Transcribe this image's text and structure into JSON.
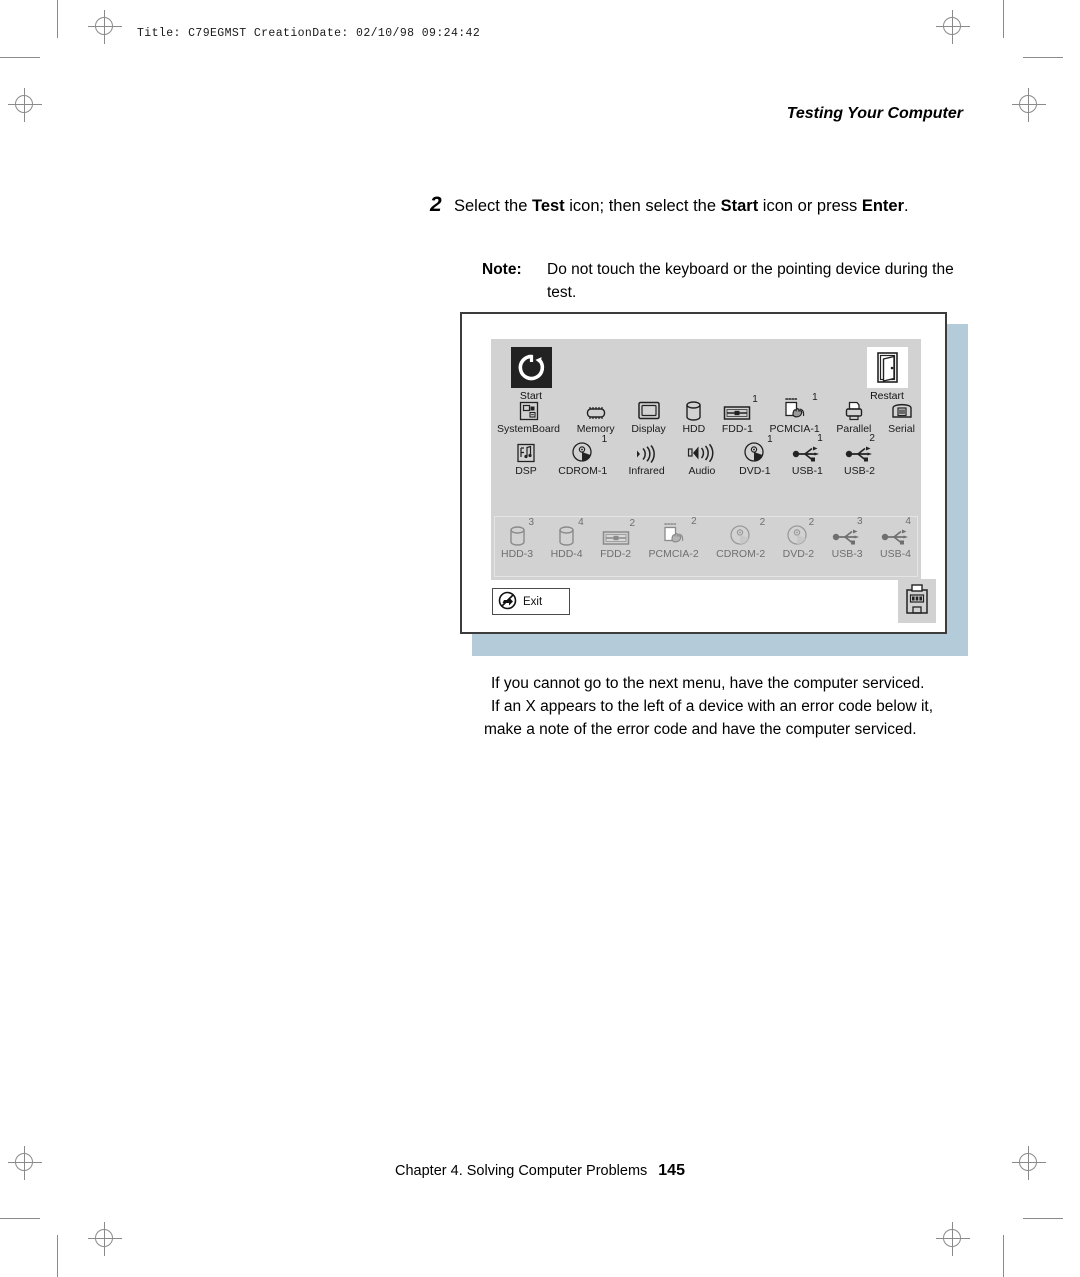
{
  "page": {
    "job_info": "Title: C79EGMST CreationDate: 02/10/98 09:24:42",
    "running_head": "Testing Your Computer",
    "footer_text": "Chapter 4.  Solving Computer Problems",
    "page_number": "145"
  },
  "step": {
    "number": "2",
    "text_part1": "Select the ",
    "bold1": "Test",
    "text_part2": " icon; then select the ",
    "bold2": "Start",
    "text_part3": " icon or press ",
    "bold3": "Enter",
    "text_part4": "."
  },
  "note": {
    "label": "Note:",
    "text": "Do not touch the keyboard or the pointing device during the test."
  },
  "figure": {
    "start_tile": {
      "label": "Start",
      "icon": "circular-arrow-icon"
    },
    "restart_tile": {
      "label": "Restart",
      "icon": "door-exit-icon"
    },
    "row1": [
      {
        "label": "SystemBoard",
        "icon": "system-board-icon",
        "sup": "",
        "dim": false
      },
      {
        "label": "Memory",
        "icon": "memory-chip-icon",
        "sup": "",
        "dim": false
      },
      {
        "label": "Display",
        "icon": "display-monitor-icon",
        "sup": "",
        "dim": false
      },
      {
        "label": "HDD",
        "icon": "hard-disk-icon",
        "sup": "",
        "dim": false
      },
      {
        "label": "FDD-1",
        "icon": "floppy-drive-icon",
        "sup": "1",
        "dim": false
      },
      {
        "label": "PCMCIA-1",
        "icon": "pcmcia-card-icon",
        "sup": "1",
        "dim": false
      },
      {
        "label": "Parallel",
        "icon": "printer-icon",
        "sup": "",
        "dim": false
      },
      {
        "label": "Serial",
        "icon": "telephone-icon",
        "sup": "",
        "dim": false
      }
    ],
    "row2": [
      {
        "label": "DSP",
        "icon": "dsp-icon",
        "sup": "",
        "dim": false
      },
      {
        "label": "CDROM-1",
        "icon": "cdrom-disc-icon",
        "sup": "1",
        "dim": false
      },
      {
        "label": "Infrared",
        "icon": "infrared-icon",
        "sup": "",
        "dim": false
      },
      {
        "label": "Audio",
        "icon": "speaker-icon",
        "sup": "",
        "dim": false
      },
      {
        "label": "DVD-1",
        "icon": "dvd-disc-icon",
        "sup": "1",
        "dim": false
      },
      {
        "label": "USB-1",
        "icon": "usb-icon",
        "sup": "1",
        "dim": false
      },
      {
        "label": "USB-2",
        "icon": "usb-icon",
        "sup": "2",
        "dim": false
      }
    ],
    "row3": [
      {
        "label": "HDD-3",
        "icon": "hard-disk-icon",
        "sup": "3",
        "dim": true
      },
      {
        "label": "HDD-4",
        "icon": "hard-disk-icon",
        "sup": "4",
        "dim": true
      },
      {
        "label": "FDD-2",
        "icon": "floppy-drive-icon",
        "sup": "2",
        "dim": true
      },
      {
        "label": "PCMCIA-2",
        "icon": "pcmcia-card-icon",
        "sup": "2",
        "dim": true
      },
      {
        "label": "CDROM-2",
        "icon": "cdrom-disc-icon",
        "sup": "2",
        "dim": true
      },
      {
        "label": "DVD-2",
        "icon": "dvd-disc-icon",
        "sup": "2",
        "dim": true
      },
      {
        "label": "USB-3",
        "icon": "usb-icon",
        "sup": "3",
        "dim": true
      },
      {
        "label": "USB-4",
        "icon": "usb-icon",
        "sup": "4",
        "dim": true
      }
    ],
    "exit_button": {
      "label": "Exit",
      "icon": "no-entry-arrow-icon"
    },
    "corner_icon": "docking-station-icon"
  },
  "body_copy": {
    "para1": "If you cannot go to the next menu, have the computer serviced.",
    "para2": "If an X appears to the left of a device with an error code below it, make a note of the error code and have the computer serviced."
  },
  "colors": {
    "panel_gray": "#d2d2d2",
    "shadow_blue": "#b4cbd9",
    "dialog_border": "#3c3c3c",
    "dim_text": "#6f6f6f"
  }
}
